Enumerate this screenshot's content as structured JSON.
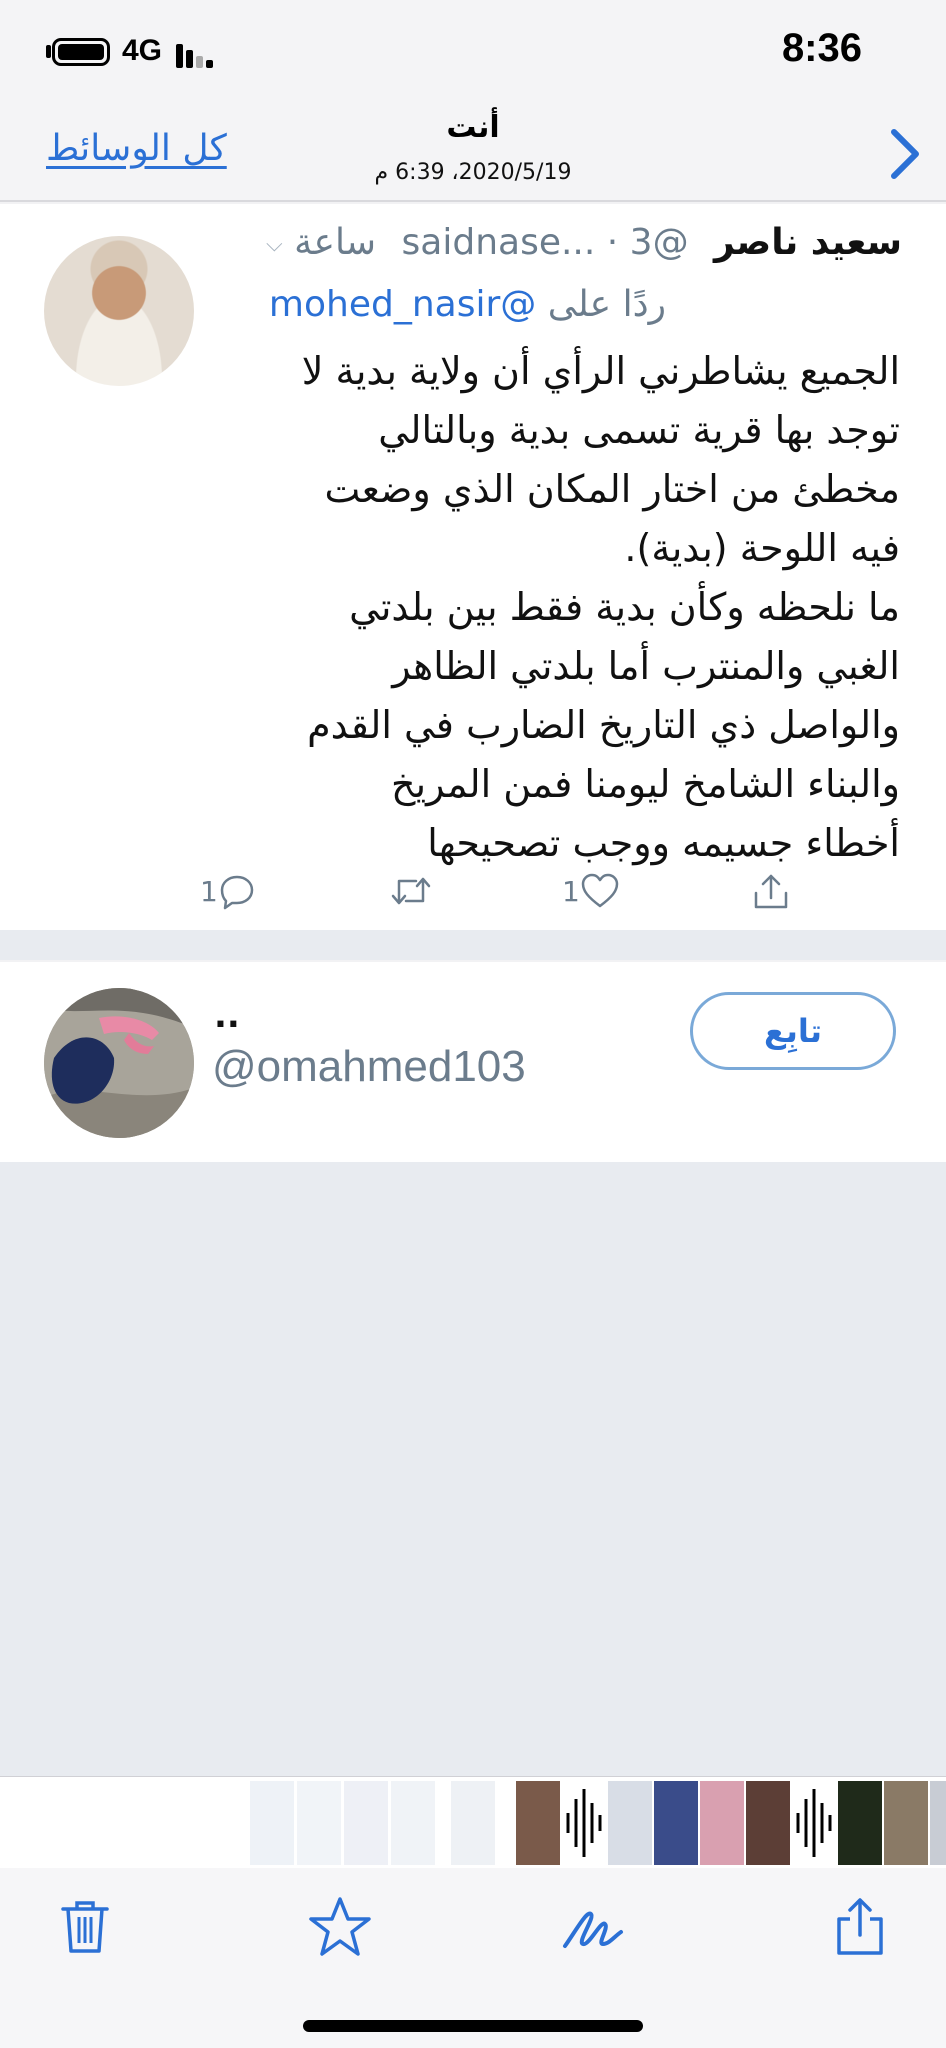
{
  "status_bar": {
    "network": "4G",
    "time": "8:36"
  },
  "nav": {
    "left_link": "كل الوسائط",
    "title": "أنت",
    "subtitle": "2020/5/19، 6:39 م"
  },
  "tweet": {
    "name": "سعيد ناصر",
    "handle": "@saidnase...",
    "separator": "·",
    "time": "3 ساعة",
    "reply_prefix": "ردًا على",
    "reply_mention": "@mohed_nasir",
    "text": "الجميع يشاطرني الرأي أن ولاية بدية لا\nتوجد بها قرية تسمى بدية وبالتالي\nمخطئ من اختار المكان الذي وضعت\nفيه اللوحة (بدية).\nما نلحظه وكأن بدية فقط بين بلدتي\nالغبي والمنترب أما بلدتي الظاهر\nوالواصل ذي التاريخ الضارب في القدم\nوالبناء الشامخ ليومنا فمن المريخ\nأخطاء جسيمه ووجب تصحيحها",
    "reply_count": "1",
    "like_count": "1"
  },
  "follow_card": {
    "display_name": "..",
    "handle": "@omahmed103",
    "button_label": "تابِع"
  },
  "colors": {
    "accent": "#2b70d5",
    "muted": "#6b7c8c",
    "background": "#e8ebf0"
  },
  "icons": [
    "chevron-right-icon",
    "reply-icon",
    "retweet-icon",
    "like-icon",
    "share-icon",
    "trash-icon",
    "star-icon",
    "markup-icon",
    "share-export-icon"
  ]
}
